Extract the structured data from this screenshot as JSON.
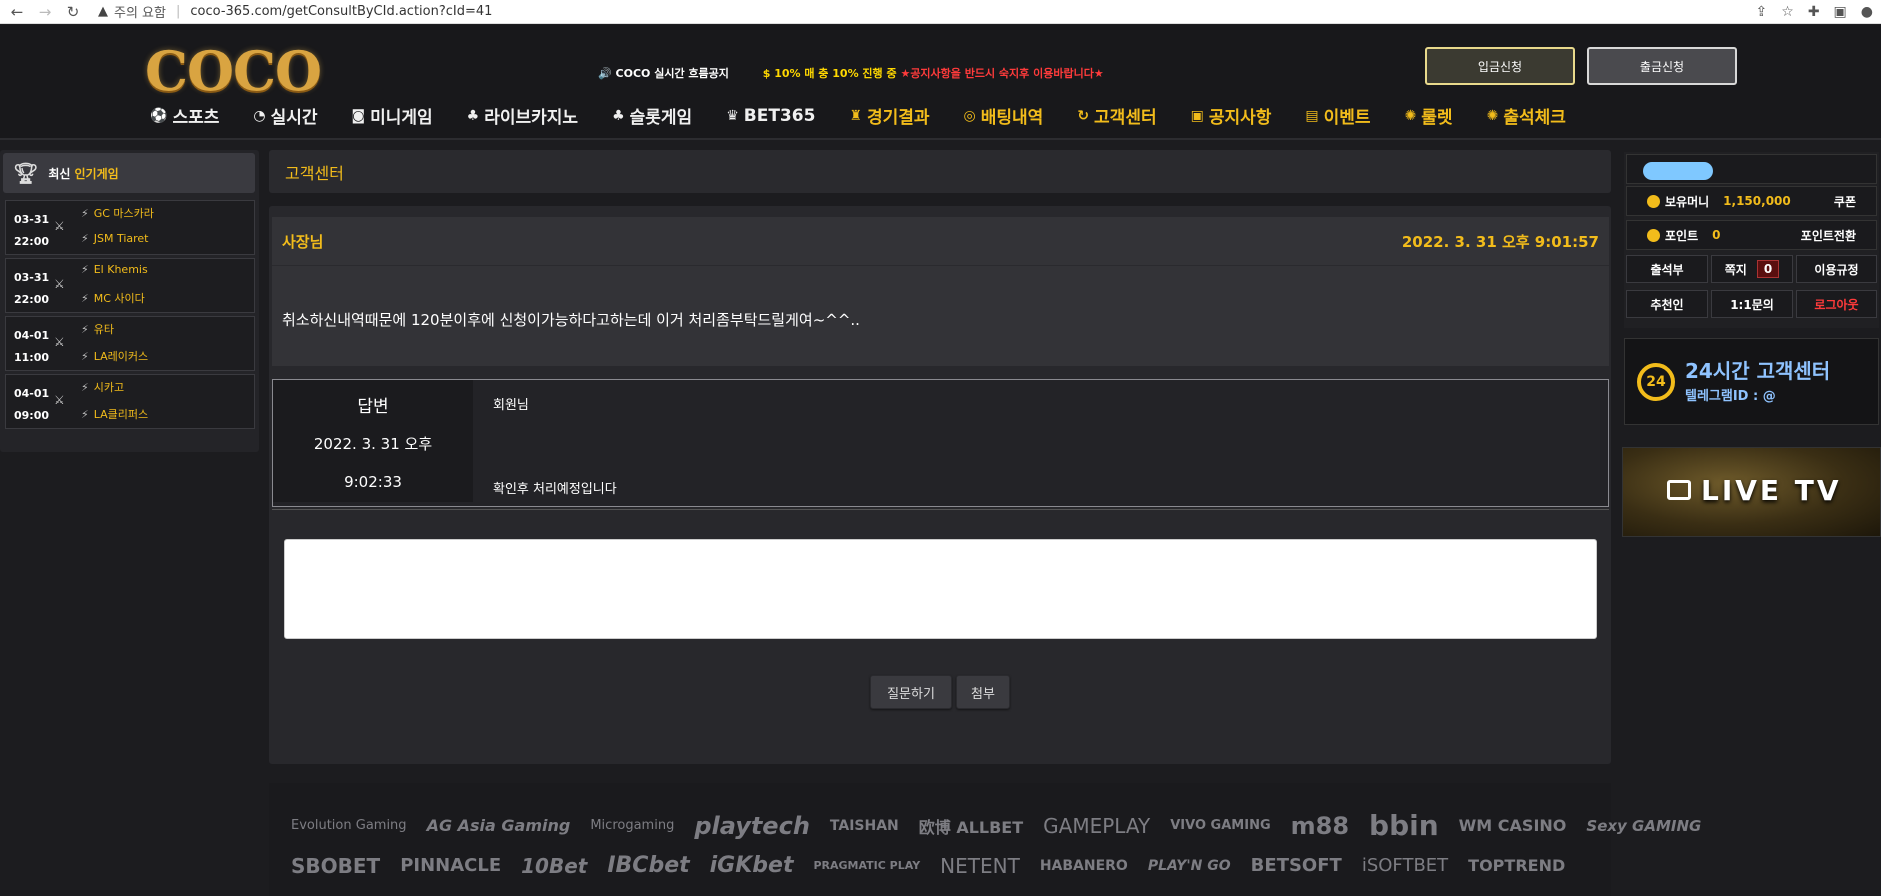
{
  "browser": {
    "security_label": "주의 요함",
    "url": "coco-365.com/getConsultByCId.action?cId=41"
  },
  "header": {
    "logo": "COCO",
    "notice_prefix": "🔊 COCO 실시간 흐름공지",
    "notice_promo": "$ 10% 매 충 10% 진행 중",
    "notice_warning": "★공지사항을 반드시 숙지후 이용바랍니다★",
    "deposit_button": "입금신청",
    "withdraw_button": "출금신청",
    "nav": [
      {
        "label": "스포츠",
        "icon": "⚽"
      },
      {
        "label": "실시간",
        "icon": "◔"
      },
      {
        "label": "미니게임",
        "icon": "◙"
      },
      {
        "label": "라이브카지노",
        "icon": "♣"
      },
      {
        "label": "슬롯게임",
        "icon": "♣"
      },
      {
        "label": "BET365",
        "icon": "♛"
      },
      {
        "label": "경기결과",
        "icon": "♜"
      },
      {
        "label": "배팅내역",
        "icon": "◎"
      },
      {
        "label": "고객센터",
        "icon": "↻"
      },
      {
        "label": "공지사항",
        "icon": "▣"
      },
      {
        "label": "이벤트",
        "icon": "▤"
      },
      {
        "label": "룰렛",
        "icon": "✺"
      },
      {
        "label": "출석체크",
        "icon": "✺"
      }
    ]
  },
  "sidebar_left": {
    "title_white": "최신",
    "title_gold": "인기게임",
    "games": [
      {
        "date": "03-31",
        "time": "22:00",
        "home": "GC 마스카라",
        "away": "JSM Tiaret"
      },
      {
        "date": "03-31",
        "time": "22:00",
        "home": "El Khemis",
        "away": "MC 사이다"
      },
      {
        "date": "04-01",
        "time": "11:00",
        "home": "유타",
        "away": "LA레이커스"
      },
      {
        "date": "04-01",
        "time": "09:00",
        "home": "시카고",
        "away": "LA클리퍼스"
      }
    ]
  },
  "main": {
    "section_title": "고객센터",
    "question": {
      "author": "사장님",
      "date": "2022. 3. 31 오후 9:01:57",
      "body": "취소하신내역때문에 120분이후에 신청이가능하다고하는데 이거 처리좀부탁드릴게여~^^.."
    },
    "answer": {
      "label": "답변",
      "date_line1": "2022. 3. 31 오후",
      "date_line2": "9:02:33",
      "greeting": "회원님",
      "message": "확인후 처리예정입니다"
    },
    "ask_button": "질문하기",
    "attach_button": "첨부",
    "providers_row1": [
      "Evolution Gaming",
      "AG Asia Gaming",
      "Microgaming",
      "playtech",
      "TAISHAN",
      "欧博 ALLBET",
      "GAMEPLAY",
      "VIVO GAMING",
      "m88",
      "bbin",
      "WM CASINO",
      "Sexy GAMING"
    ],
    "providers_row2": [
      "SBOBET",
      "PINNACLE",
      "10Bet",
      "IBCbet",
      "iGKbet",
      "PRAGMATIC PLAY",
      "NETENT",
      "HABANERO",
      "PLAY'N GO",
      "BETSOFT",
      "iSOFTBET",
      "TOPTREND"
    ]
  },
  "sidebar_right": {
    "money_label": "보유머니",
    "money_value": "1,150,000",
    "coupon": "쿠폰",
    "point_label": "포인트",
    "point_value": "0",
    "point_convert": "포인트전환",
    "attendance": "출석부",
    "messages": "쪽지",
    "message_count": "0",
    "rules": "이용규정",
    "referrer": "추천인",
    "inquiry": "1:1문의",
    "logout": "로그아웃",
    "cs_badge": "24",
    "cs_title": "24시간 고객센터",
    "cs_telegram": "텔레그램ID : @",
    "live_tv": "LIVE TV"
  }
}
